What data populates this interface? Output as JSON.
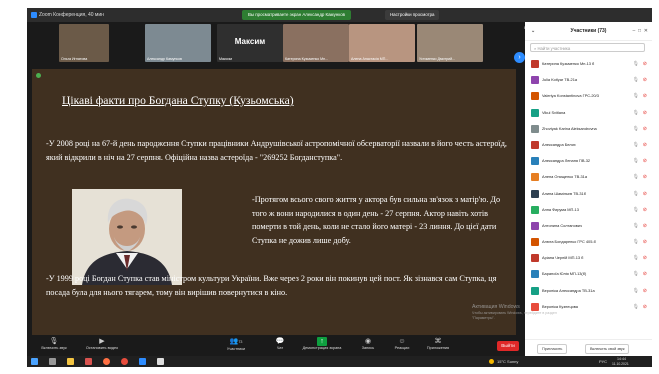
{
  "window": {
    "app_title": "Zoom Конференция, 40 мин",
    "share_banner": "Вы просматриваете экран Александр Камунков",
    "view_options": "Настройки просмотра",
    "view_toggle": "Вид"
  },
  "thumbnails": [
    {
      "label": "Ольга Игнатова",
      "bg": "#6b5a48"
    },
    {
      "label": "Александр Камунков",
      "bg": "#7d8a92"
    },
    {
      "label": "Максим",
      "bg": "#2f2f2f",
      "big_name": "Максим"
    },
    {
      "label": "Катерина Кузьменко Мп...",
      "bg": "#8a7060"
    },
    {
      "label": "Алена Анастасія МП...",
      "bg": "#b89580"
    },
    {
      "label": "Устименко Дмитрий...",
      "bg": "#9a8876"
    }
  ],
  "slide": {
    "title": "Цікаві факти про Богдана Ступку (Кузьомська)",
    "paragraph1": "-У 2008 році на 67-й день пароджєння Ступки працівники Андрушівської астропомічної обсерваторії назвали в його честь астероїд, який відкрили в ніч на 27 серпня. Офіційна назва астероїда - \"269252 Богданступка\".",
    "paragraph2": "-Протягом всього свого життя у актора був сильна зв'язок з матір'ю. До того ж вони народилися в один день - 27 серпня. Актор навіть хотів померти в той день, коли не стало його матері - 23 линня. До цієї дати Ступка не дожив лише добу.",
    "paragraph3": "-У 1999 році Богдан Ступка став міністром культури України. Вже через 2 роки він покинув цей пост. Як зізнався сам Ступка, ця посада була для нього тягарем, тому він вирішив повернутися в кіно."
  },
  "participants_panel": {
    "title": "Участники (73)",
    "search_placeholder": "Найти участника",
    "participants": [
      {
        "name": "Катерина Кузьменко Мп-13 б",
        "color": "#c0392b"
      },
      {
        "name": "Julia Kotlyar ТВ-21а",
        "color": "#8e44ad"
      },
      {
        "name": "Valeriya Konstantinova ГРС-20/3",
        "color": "#d35400"
      },
      {
        "name": "Vikul Svitlana",
        "color": "#16a085"
      },
      {
        "name": "Zhovtyak Karina Aleksandrovna",
        "color": "#7f8c8d"
      },
      {
        "name": "Александра Белих",
        "color": "#c0392b"
      },
      {
        "name": "Александра Лепаня ПВ-32",
        "color": "#2980b9"
      },
      {
        "name": "Алена Онищенко ТВ-31а",
        "color": "#e67e22"
      },
      {
        "name": "Алина Шамільєв ТВ-31б",
        "color": "#2c3e50"
      },
      {
        "name": "Анна Фирума МП-13",
        "color": "#27ae60"
      },
      {
        "name": "Антонина Солтанович",
        "color": "#8e44ad"
      },
      {
        "name": "Анюта Бондаренко ГРС 405-б",
        "color": "#d35400"
      },
      {
        "name": "Аріана Чернiй МП-13 б",
        "color": "#c0392b"
      },
      {
        "name": "Бараноїа Юлія МП-13(б)",
        "color": "#2980b9"
      },
      {
        "name": "Вероніка Александра ТВ-31а",
        "color": "#16a085"
      },
      {
        "name": "Вероніка Кузнецова",
        "color": "#e74c3c"
      }
    ],
    "invite_button": "Пригласить",
    "unmute_button": "Включить свой звук"
  },
  "toolbar": {
    "mic": "Включить звук",
    "video": "Остановить видео",
    "participants": "Участники",
    "participants_count": "73",
    "chat": "Чат",
    "share": "Демонстрация экрана",
    "record": "Запись",
    "reactions": "Реакции",
    "apps": "Приложения",
    "leave": "Выйти"
  },
  "activation": {
    "line1": "Активация Windows",
    "line2": "Чтобы активировать Windows, перейдите в раздел",
    "line3": "\"Параметры\"."
  },
  "taskbar": {
    "weather": "15°C Sunny",
    "lang": "РУС",
    "time": "14:44",
    "date": "11.10.2021"
  }
}
